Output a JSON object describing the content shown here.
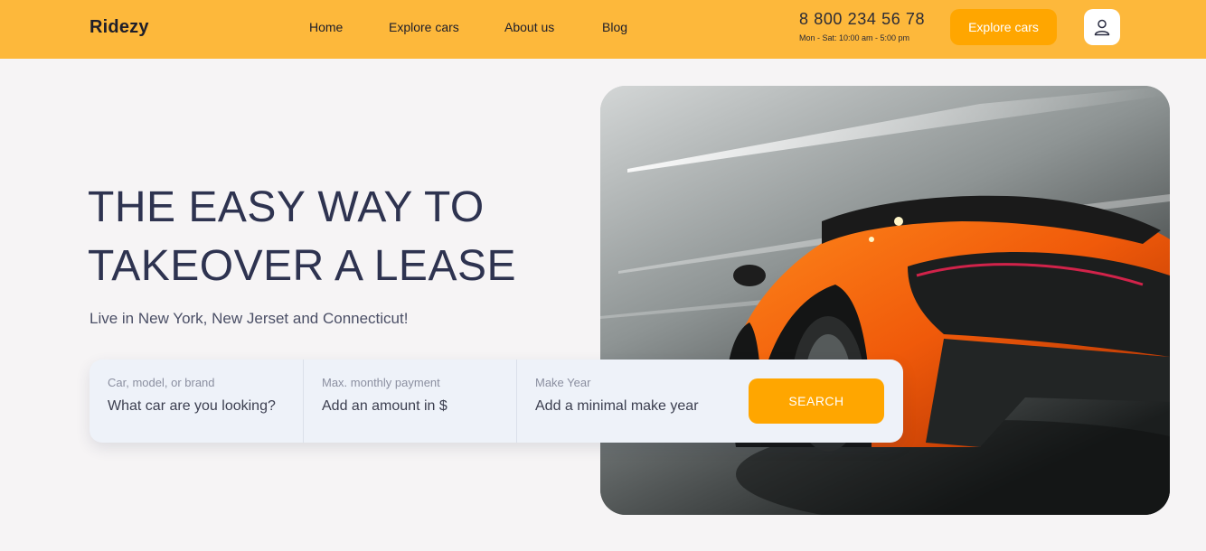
{
  "header": {
    "logo": "Ridezy",
    "nav": [
      {
        "label": "Home"
      },
      {
        "label": "Explore cars"
      },
      {
        "label": "About us"
      },
      {
        "label": "Blog"
      }
    ],
    "phone": "8 800 234 56 78",
    "hours": "Mon - Sat: 10:00 am - 5:00 pm",
    "cta_label": "Explore cars",
    "user_icon": "user-icon"
  },
  "hero": {
    "title_line1": "THE EASY WAY TO",
    "title_line2": "TAKEOVER A LEASE",
    "subtitle": "Live in New York, New Jerset and Connecticut!"
  },
  "search": {
    "fields": [
      {
        "label": "Car, model, or brand",
        "placeholder": "What car are you looking?"
      },
      {
        "label": "Max. monthly payment",
        "placeholder": "Add an amount in $"
      },
      {
        "label": "Make Year",
        "placeholder": "Add a minimal make year"
      }
    ],
    "button_label": "SEARCH"
  },
  "colors": {
    "header_bg": "#fdb83b",
    "accent": "#ffa600",
    "page_bg": "#f6f4f5",
    "title": "#2e3350"
  }
}
